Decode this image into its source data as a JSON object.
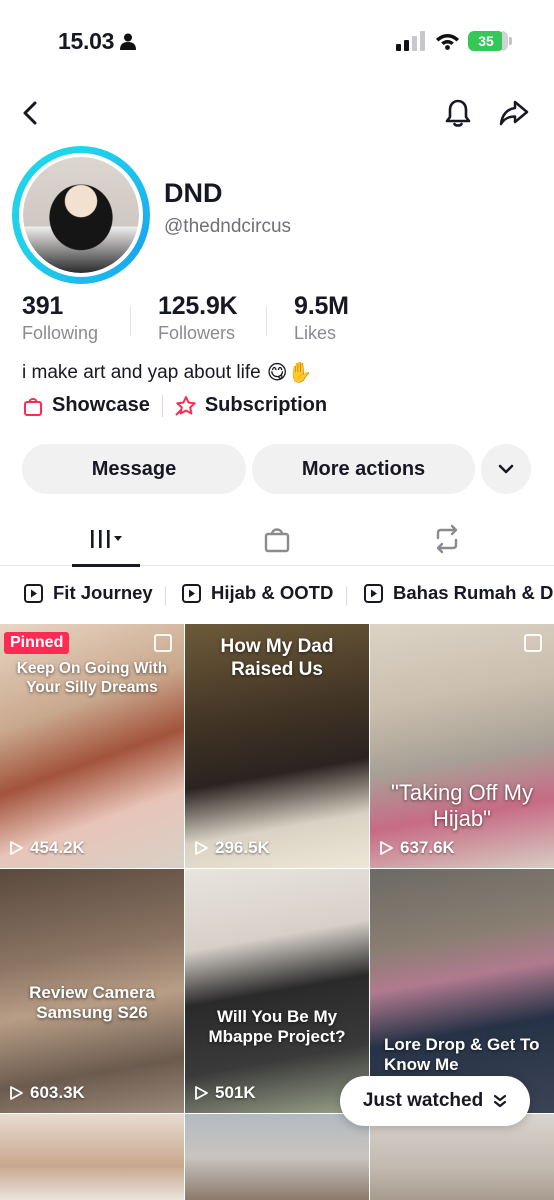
{
  "status_bar": {
    "time": "15.03",
    "battery": "35"
  },
  "profile": {
    "name": "DND",
    "handle": "@thedndcircus",
    "stats": [
      {
        "value": "391",
        "label": "Following"
      },
      {
        "value": "125.9K",
        "label": "Followers"
      },
      {
        "value": "9.5M",
        "label": "Likes"
      }
    ],
    "bio": "i make art and yap about life",
    "bio_emojis": "😋✋",
    "links": {
      "showcase": "Showcase",
      "subscription": "Subscription"
    }
  },
  "actions": {
    "message": "Message",
    "more_actions": "More actions"
  },
  "playlists": [
    "Fit Journey",
    "Hijab & OOTD",
    "Bahas Rumah & De"
  ],
  "videos": [
    {
      "views": "454.2K",
      "caption": "Keep On Going With Your Silly Dreams",
      "badge": "Pinned"
    },
    {
      "views": "296.5K",
      "caption": "How My Dad Raised Us"
    },
    {
      "views": "637.6K",
      "caption": "\"Taking Off My Hijab\""
    },
    {
      "views": "603.3K",
      "caption": "Review Camera Samsung S26"
    },
    {
      "views": "501K",
      "caption": "Will You Be My Mbappe Project?"
    },
    {
      "views": "",
      "caption": "Lore Drop & Get To Know Me"
    }
  ],
  "floating": {
    "just_watched": "Just watched"
  },
  "colors": {
    "accent": "#fe2c55",
    "ring": "#20d5ec",
    "battery": "#36c759"
  }
}
